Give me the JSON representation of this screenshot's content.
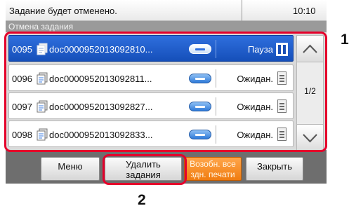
{
  "status": {
    "message": "Задание будет отменено.",
    "time": "10:10"
  },
  "screen_title": "Отмена задания",
  "jobs": [
    {
      "number": "0095",
      "name": "doc0000952013092810...",
      "status": "Пауза",
      "status_icon": "pause-icon",
      "selected": true
    },
    {
      "number": "0096",
      "name": "doc0000952013092811...",
      "status": "Ожидан.",
      "status_icon": "waiting-document-icon",
      "selected": false
    },
    {
      "number": "0097",
      "name": "doc0000952013092827...",
      "status": "Ожидан.",
      "status_icon": "waiting-document-icon",
      "selected": false
    },
    {
      "number": "0098",
      "name": "doc0000952013092833...",
      "status": "Ожидан.",
      "status_icon": "waiting-document-icon",
      "selected": false
    }
  ],
  "pagination": {
    "indicator": "1/2"
  },
  "buttons": {
    "menu": "Меню",
    "delete_line1": "Удалить",
    "delete_line2": "задания",
    "resume_line1": "Возобн. все",
    "resume_line2": "здн. печати",
    "close": "Закрыть"
  },
  "callouts": {
    "one": "1",
    "two": "2"
  },
  "colors": {
    "selected_row": "#1f5fcf",
    "resume_button": "#f28a1e",
    "callout": "#e5002b"
  }
}
